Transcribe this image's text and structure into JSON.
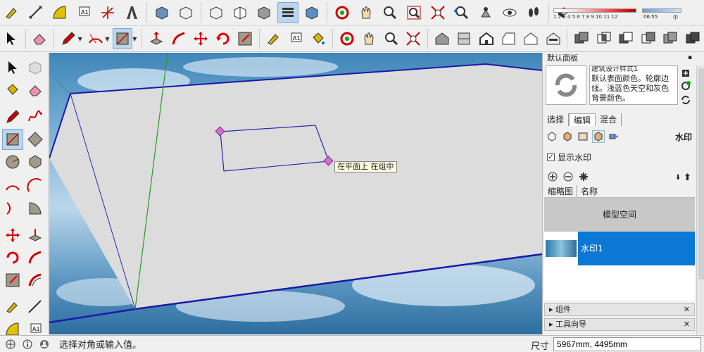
{
  "toolbar": {
    "legend_numbers": "1 2 3 4 5 6 7 8 9 10 11 12",
    "time_start": "06:55",
    "time_end": "中"
  },
  "panel": {
    "title": "默认面板",
    "pin": "▪",
    "style_name": "建筑设计样式1",
    "style_description": "默认表面颜色。轮廓边线。浅蓝色天空和灰色背景颜色。",
    "tabs": [
      "选择",
      "编辑",
      "混合"
    ],
    "section_label": "水印",
    "show_watermark_label": "显示水印",
    "show_watermark_checked": true,
    "list_headers": [
      "缩略图",
      "名称"
    ],
    "rows": [
      "模型空间",
      "水印1"
    ],
    "collapsed_sections": [
      "组件",
      "工具向导"
    ]
  },
  "viewport": {
    "tooltip": "在平面上 在组中"
  },
  "statusbar": {
    "prompt": "选择对角或输入值。",
    "measurements_label": "尺寸",
    "measurements_value": "5967mm, 4495mm"
  },
  "colors": {
    "selection_blue": "#0a78d4",
    "edge_blue": "#1a1aa8",
    "axis_green": "#2a9a2a",
    "inference_magenta": "#c050c0"
  }
}
